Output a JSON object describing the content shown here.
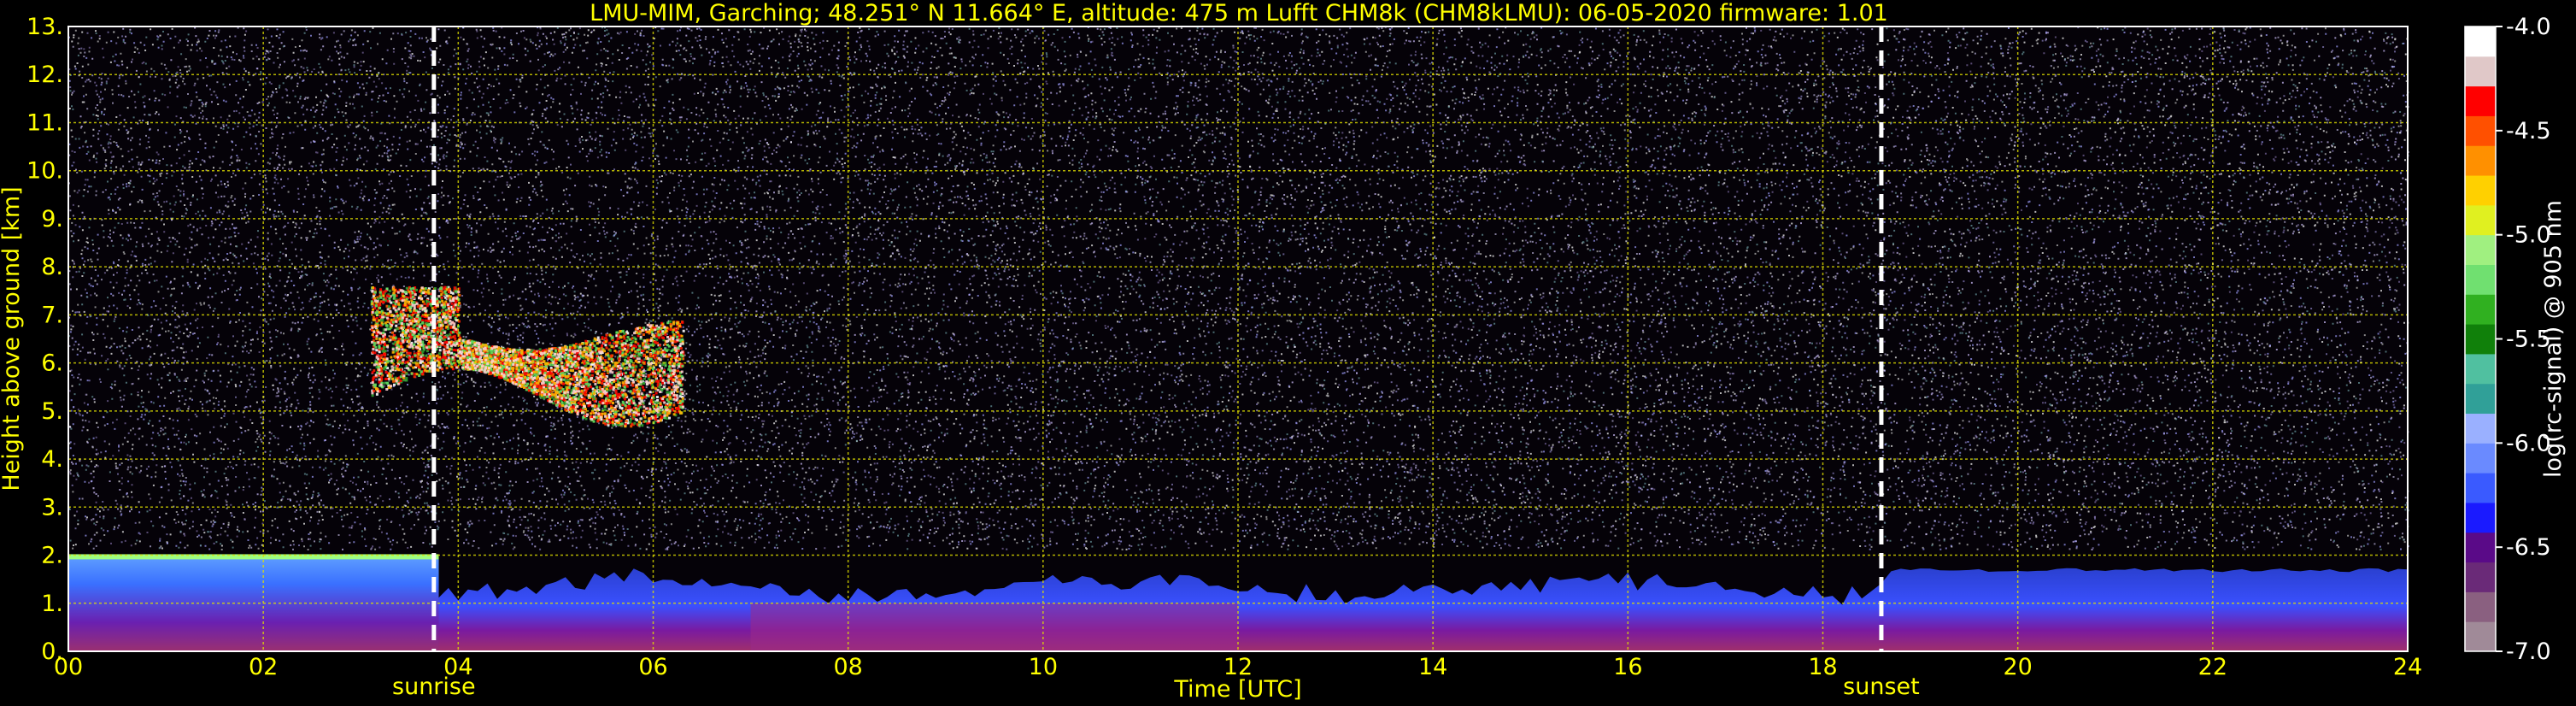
{
  "chart_data": {
    "type": "heatmap",
    "title": "LMU-MIM, Garching; 48.251° N 11.664° E, altitude: 475 m    Lufft CHM8k (CHM8kLMU): 06-05-2020    firmware: 1.01",
    "xlabel": "Time [UTC]",
    "ylabel": "Height above ground [km]",
    "xlim": [
      0,
      24
    ],
    "ylim": [
      0,
      13
    ],
    "x_ticks": [
      "00",
      "02",
      "04",
      "06",
      "08",
      "10",
      "12",
      "14",
      "16",
      "18",
      "20",
      "22",
      "24"
    ],
    "y_ticks": [
      "0.",
      "1.",
      "2.",
      "3.",
      "4.",
      "5.",
      "6.",
      "7.",
      "8.",
      "9.",
      "10.",
      "11.",
      "12.",
      "13."
    ],
    "grid": true,
    "markers": [
      {
        "label": "sunrise",
        "x": 3.75
      },
      {
        "label": "sunset",
        "x": 18.6
      }
    ],
    "colorbar": {
      "label": "log(rc-signal) @ 905 nm",
      "range": [
        -7.0,
        -4.0
      ],
      "ticks": [
        "-4.0",
        "-4.5",
        "-5.0",
        "-5.5",
        "-6.0",
        "-6.5",
        "-7.0"
      ],
      "colors": [
        "#a08a98",
        "#8a6080",
        "#6a2a78",
        "#5a0a88",
        "#1a1aff",
        "#3a5aff",
        "#6a8aff",
        "#9ab0ff",
        "#30a098",
        "#50c0a0",
        "#10800a",
        "#30b020",
        "#70e070",
        "#a0f080",
        "#e0f020",
        "#ffd000",
        "#ff9000",
        "#ff5000",
        "#ff0000",
        "#e0c8c8",
        "#ffffff"
      ]
    },
    "features": [
      {
        "name": "cirrus layer",
        "x_range": [
          3.1,
          6.3
        ],
        "y_range": [
          5.1,
          7.6
        ]
      },
      {
        "name": "boundary layer",
        "x_range": [
          0,
          24
        ],
        "y_range": [
          0,
          2.0
        ]
      }
    ]
  }
}
